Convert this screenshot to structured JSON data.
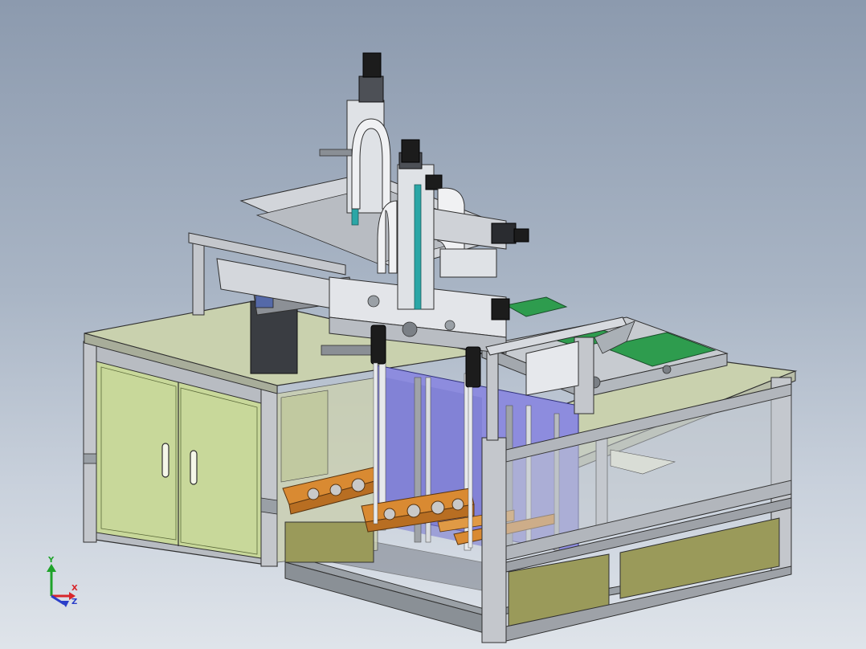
{
  "triad": {
    "y_label": "Y",
    "x_label": "X",
    "z_label": "Z",
    "y_color": "#1fa32a",
    "x_color": "#d8262b",
    "z_color": "#2b3fc9"
  },
  "colors": {
    "background_top": "#8c9aae",
    "table_top": "#c9d1ae",
    "cabinet_door": "#c8d89a",
    "frame": "#c4c7cc",
    "lower_panel": "#9a9a5a",
    "pcb_board": "#2e9c4e",
    "tray_rack": "#d98a32",
    "lift_plate": "#8d8cde",
    "motor": "#1c1c1c",
    "rail_accent": "#2aa6a6"
  }
}
